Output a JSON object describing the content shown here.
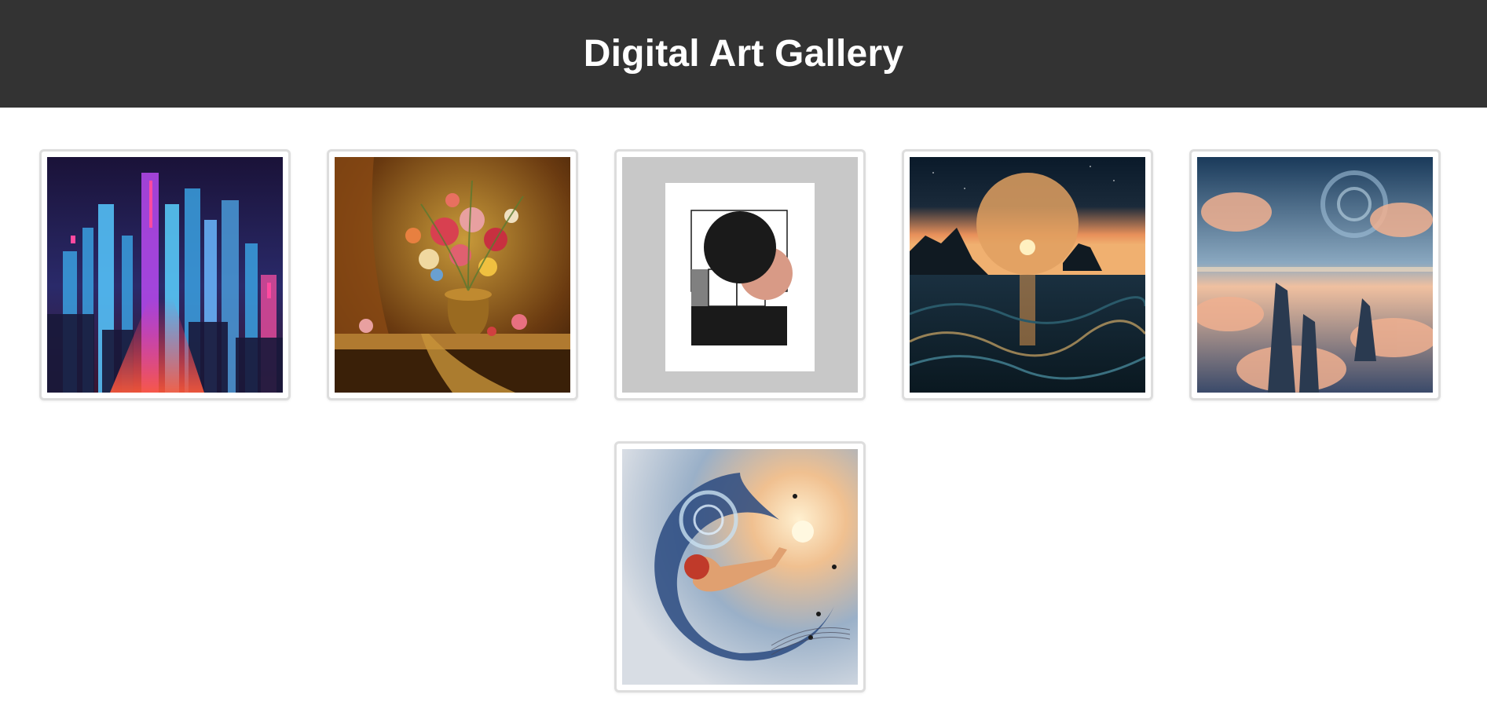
{
  "header": {
    "title": "Digital Art Gallery"
  },
  "gallery": {
    "items": [
      {
        "subject": "neon-city-artwork"
      },
      {
        "subject": "flower-still-life-artwork"
      },
      {
        "subject": "abstract-geometric-artwork"
      },
      {
        "subject": "ocean-sunset-artwork"
      },
      {
        "subject": "dreamscape-clouds-artwork"
      },
      {
        "subject": "cosmic-music-artwork"
      }
    ]
  },
  "colors": {
    "header_bg": "#333333",
    "header_text": "#ffffff",
    "page_bg": "#ffffff",
    "card_border": "#dddddd"
  }
}
